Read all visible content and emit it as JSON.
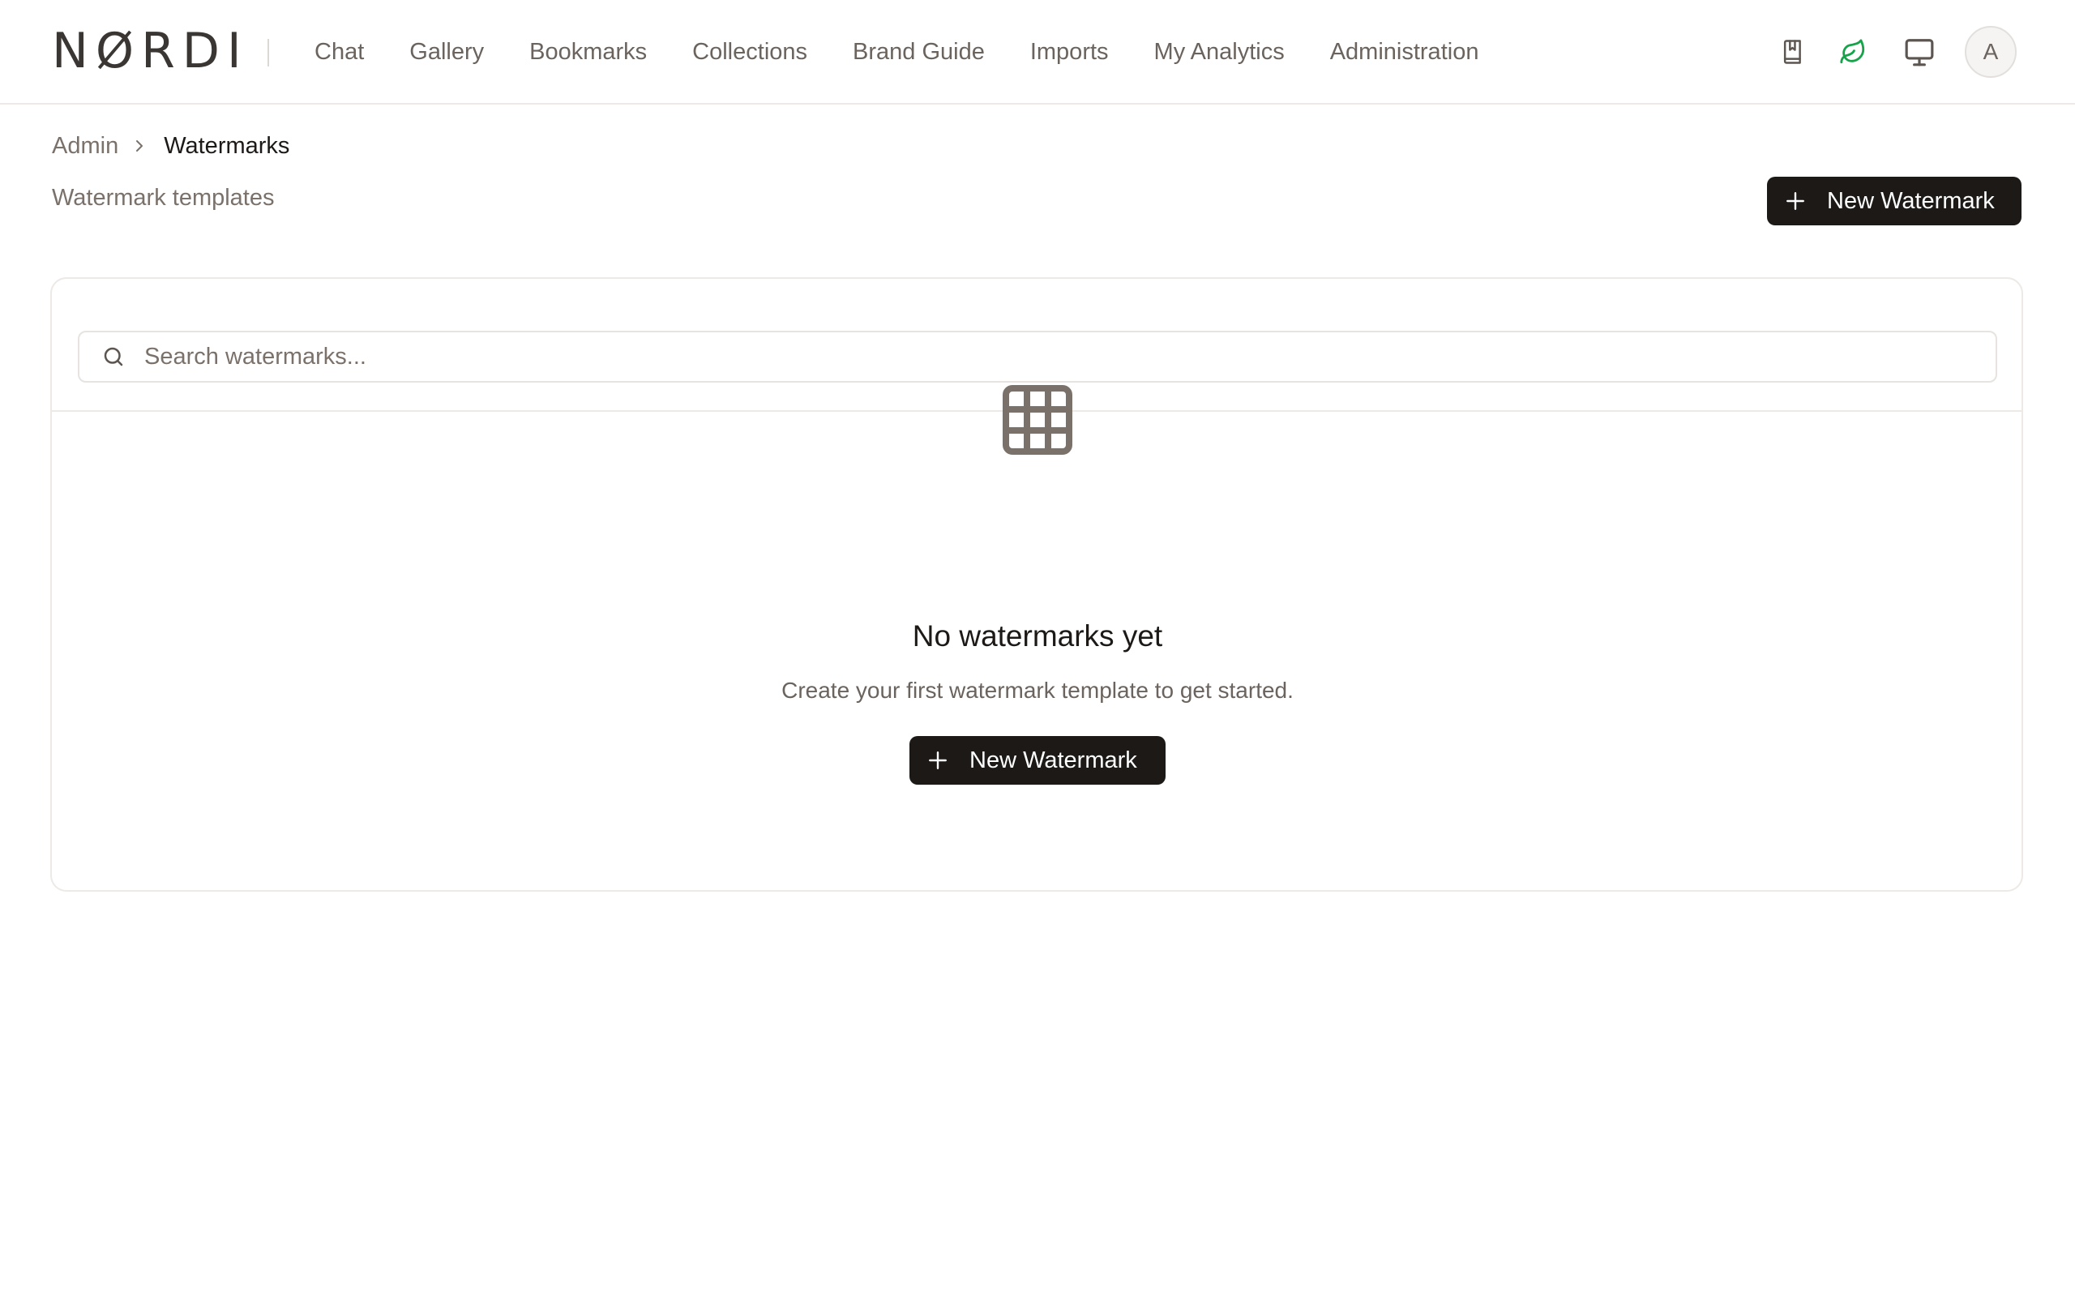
{
  "brand": {
    "logo_text": "NØRDI"
  },
  "nav": {
    "items": [
      {
        "label": "Chat"
      },
      {
        "label": "Gallery"
      },
      {
        "label": "Bookmarks"
      },
      {
        "label": "Collections"
      },
      {
        "label": "Brand Guide"
      },
      {
        "label": "Imports"
      },
      {
        "label": "My Analytics"
      },
      {
        "label": "Administration"
      }
    ]
  },
  "header_icons": {
    "bookmark": "bookmark-icon",
    "leaf": "leaf-icon",
    "monitor": "monitor-icon",
    "leaf_color": "#16a34a"
  },
  "user": {
    "avatar_initial": "A"
  },
  "breadcrumb": {
    "root": "Admin",
    "current": "Watermarks"
  },
  "page": {
    "subtitle": "Watermark templates",
    "new_button_label": "New Watermark"
  },
  "search": {
    "placeholder": "Search watermarks...",
    "value": ""
  },
  "empty_state": {
    "icon": "grid-icon",
    "title": "No watermarks yet",
    "description": "Create your first watermark template to get started.",
    "button_label": "New Watermark"
  },
  "colors": {
    "primary_button": "#1c1917",
    "text_muted": "#7a716a",
    "border": "#ece9e6"
  }
}
